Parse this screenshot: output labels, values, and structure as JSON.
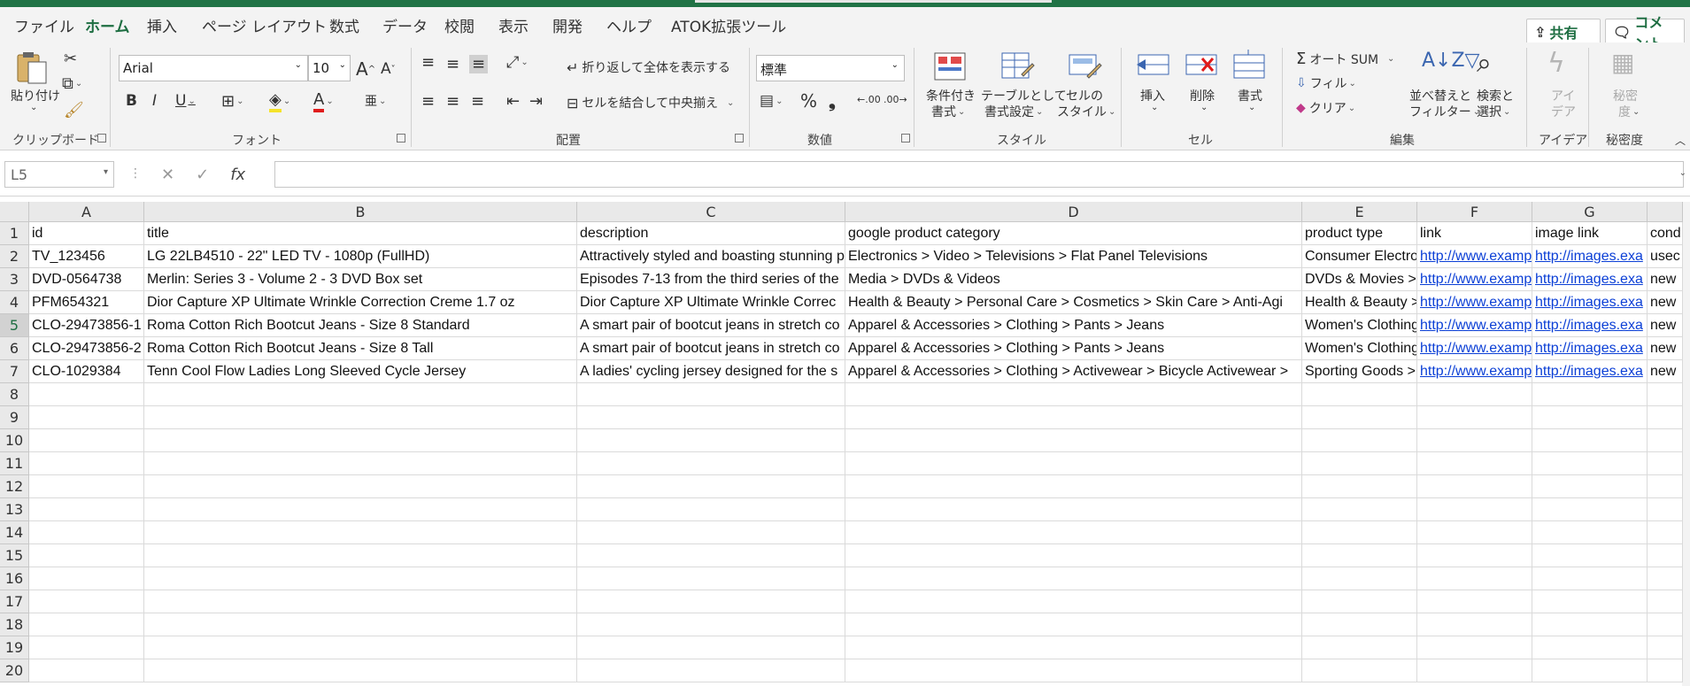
{
  "ribbon_tabs": [
    "ファイル",
    "ホーム",
    "挿入",
    "ページ レイアウト",
    "数式",
    "データ",
    "校閲",
    "表示",
    "開発",
    "ヘルプ",
    "ATOK拡張ツール"
  ],
  "share_label": "共有",
  "comment_label": "コメント",
  "clipboard": {
    "paste_label": "貼り付け",
    "group": "クリップボード"
  },
  "font": {
    "name": "Arial",
    "size": "10",
    "group": "フォント"
  },
  "alignment": {
    "wrap_label": "折り返して全体を表示する",
    "merge_label": "セルを結合して中央揃え",
    "group": "配置"
  },
  "number": {
    "format": "標準",
    "group": "数値"
  },
  "styles": {
    "conditional": [
      "条件付き",
      "書式"
    ],
    "table": [
      "テーブルとして",
      "書式設定"
    ],
    "cell": [
      "セルの",
      "スタイル"
    ],
    "group": "スタイル"
  },
  "cells": {
    "insert": "挿入",
    "delete": "削除",
    "format": "書式",
    "group": "セル"
  },
  "editing": {
    "autosum": "オート SUM",
    "fill": "フィル",
    "clear": "クリア",
    "sort": [
      "並べ替えと",
      "フィルター"
    ],
    "find": [
      "検索と",
      "選択"
    ],
    "group": "編集"
  },
  "ideas": {
    "label": [
      "アイ",
      "デア"
    ],
    "group": "アイデア"
  },
  "sensitivity": {
    "label": [
      "秘密",
      "度"
    ],
    "group": "秘密度"
  },
  "name_box": "L5",
  "columns": [
    "A",
    "B",
    "C",
    "D",
    "E",
    "F",
    "G",
    ""
  ],
  "row_numbers": [
    "1",
    "2",
    "3",
    "4",
    "5",
    "6",
    "7",
    "8",
    "9",
    "10",
    "11",
    "12",
    "13",
    "14",
    "15",
    "16",
    "17",
    "18",
    "19",
    "20"
  ],
  "rows": [
    [
      "id",
      "title",
      "description",
      "google product category",
      "product type",
      "link",
      "image link",
      "cond"
    ],
    [
      "TV_123456",
      "LG 22LB4510 - 22\" LED TV - 1080p (FullHD)",
      "Attractively styled and boasting stunning p",
      "Electronics > Video > Televisions > Flat Panel Televisions",
      "Consumer Electro",
      "http://www.examp",
      "http://images.exa",
      "usec"
    ],
    [
      "DVD-0564738",
      "Merlin: Series 3 - Volume 2 - 3 DVD Box set",
      "Episodes 7-13 from the third series of the",
      "Media > DVDs & Videos",
      "DVDs & Movies >",
      "http://www.examp",
      "http://images.exa",
      "new"
    ],
    [
      "PFM654321",
      "Dior Capture XP Ultimate Wrinkle Correction Creme 1.7 oz",
      "Dior Capture XP Ultimate Wrinkle Correc",
      "Health & Beauty > Personal Care > Cosmetics > Skin Care > Anti-Agi",
      "Health & Beauty >",
      "http://www.examp",
      "http://images.exa",
      "new"
    ],
    [
      "CLO-29473856-1",
      "Roma Cotton Rich Bootcut Jeans - Size 8 Standard",
      "A smart pair of bootcut jeans in stretch co",
      "Apparel & Accessories > Clothing > Pants > Jeans",
      "Women's Clothing",
      "http://www.examp",
      "http://images.exa",
      "new"
    ],
    [
      "CLO-29473856-2",
      "Roma Cotton Rich Bootcut Jeans - Size 8 Tall",
      "A smart pair of bootcut jeans in stretch co",
      "Apparel & Accessories > Clothing > Pants > Jeans",
      "Women's Clothing",
      "http://www.examp",
      "http://images.exa",
      "new"
    ],
    [
      "CLO-1029384",
      "Tenn Cool Flow Ladies Long Sleeved Cycle Jersey",
      "A ladies' cycling jersey designed for the s",
      "Apparel & Accessories > Clothing > Activewear > Bicycle Activewear >",
      "Sporting Goods >",
      "http://www.examp",
      "http://images.exa",
      "new"
    ]
  ]
}
